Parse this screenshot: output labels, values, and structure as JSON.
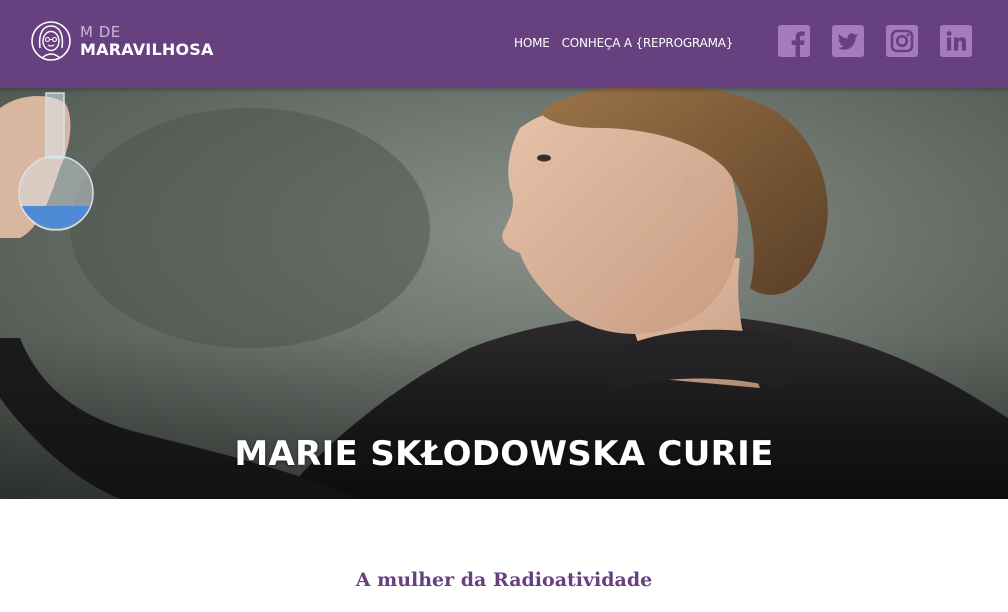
{
  "brand": {
    "line1": "M DE",
    "line2": "MARAVILHOSA"
  },
  "nav": {
    "items": [
      {
        "label": "HOME"
      },
      {
        "label": "CONHEÇA A {REPROGRAMA}"
      }
    ]
  },
  "social": [
    {
      "icon": "facebook-icon"
    },
    {
      "icon": "twitter-icon"
    },
    {
      "icon": "instagram-icon"
    },
    {
      "icon": "linkedin-icon"
    }
  ],
  "hero": {
    "title": "MARIE SKŁODOWSKA CURIE"
  },
  "content": {
    "subtitle": "A mulher da Radioatividade"
  },
  "colors": {
    "header_bg": "#67417f",
    "social_icon_bg": "#a57bbd",
    "subtitle": "#67417f"
  }
}
